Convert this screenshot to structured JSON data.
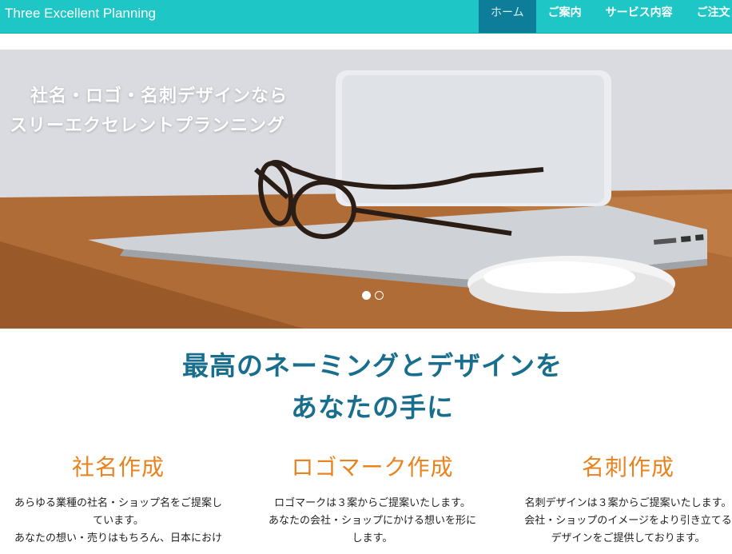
{
  "navbar": {
    "brand": "Three Excellent Planning",
    "items": [
      "ホーム",
      "ご案内",
      "サービス内容",
      "ご注文"
    ]
  },
  "hero": {
    "caption_line1": "社名・ロゴ・名刺デザインなら",
    "caption_line2": "スリーエクセレントプランニング",
    "slide_count": 2,
    "active_slide": 1
  },
  "headline": {
    "line1": "最高のネーミングとデザインを",
    "line2": "あなたの手に"
  },
  "services": [
    {
      "title": "社名作成",
      "lines": [
        "あらゆる業種の社名・ショップ名をご提案し",
        "ています。",
        "あなたの想い・売りはもちろん、日本におけ"
      ]
    },
    {
      "title": "ロゴマーク作成",
      "lines": [
        "ロゴマークは３案からご提案いたします。",
        "あなたの会社・ショップにかける想いを形に",
        "します。"
      ]
    },
    {
      "title": "名刺作成",
      "lines": [
        "名刺デザインは３案からご提案いたします。",
        "会社・ショップのイメージをより引き立てる",
        "デザインをご提供しております。"
      ]
    }
  ],
  "colors": {
    "navbar": "#1ec6c6",
    "nav_active": "#0d7d9a",
    "headline": "#186e8c",
    "service_title": "#e8831f"
  }
}
